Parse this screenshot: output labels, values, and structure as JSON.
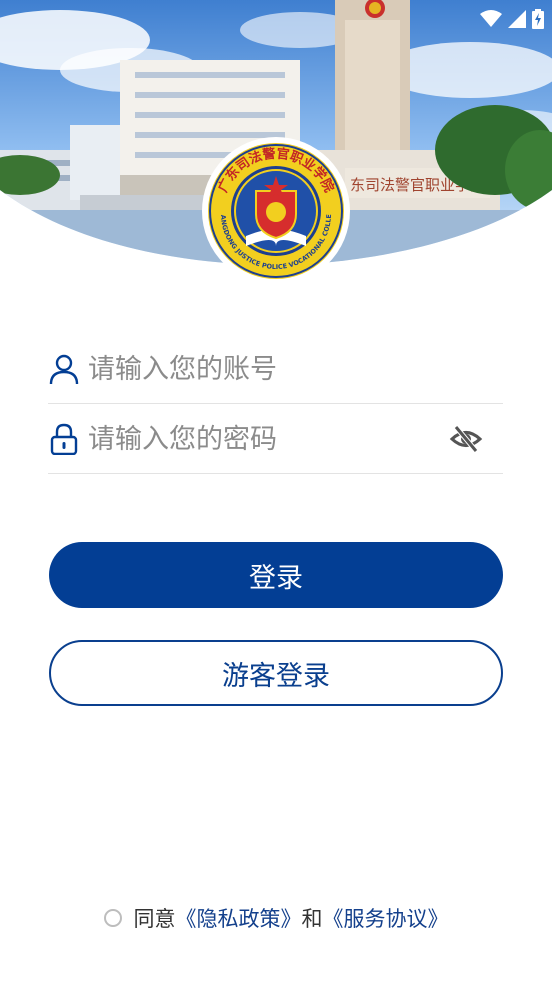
{
  "status_bar": {
    "icons": [
      "wifi-icon",
      "cellular-signal-icon",
      "battery-charging-icon"
    ]
  },
  "banner": {
    "school_sign": "东司法警官职业学院"
  },
  "logo": {
    "top_text": "广东司法警官职业学院",
    "bottom_text": "GUANGDONG JUSTICE POLICE VOCATIONAL COLLEGE"
  },
  "form": {
    "account": {
      "placeholder": "请输入您的账号",
      "value": "",
      "icon": "user-icon"
    },
    "password": {
      "placeholder": "请输入您的密码",
      "value": "",
      "icon": "lock-icon",
      "toggle_icon": "eye-off-icon"
    }
  },
  "buttons": {
    "login_label": "登录",
    "guest_label": "游客登录"
  },
  "agreement": {
    "prefix": "同意",
    "privacy_link": "《隐私政策》",
    "conjunction": "和",
    "service_link": "《服务协议》",
    "checked": false
  },
  "colors": {
    "primary": "#033e94",
    "link": "#14408c",
    "placeholder": "#8b8b8b"
  }
}
